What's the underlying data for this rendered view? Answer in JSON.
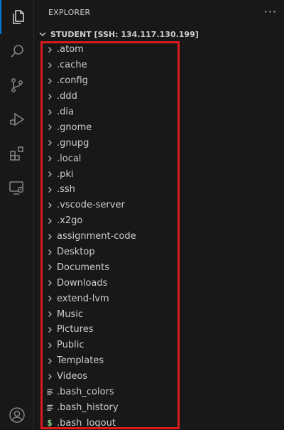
{
  "colors": {
    "background": "#181818",
    "text": "#cccccc",
    "active_indicator": "#0078d4",
    "highlight_border": "#d81c1c",
    "shell_icon": "#89d185"
  },
  "activity_bar": {
    "items": [
      {
        "icon": "files-icon",
        "active": true
      },
      {
        "icon": "search-icon",
        "active": false
      },
      {
        "icon": "source-control-icon",
        "active": false
      },
      {
        "icon": "run-debug-icon",
        "active": false
      },
      {
        "icon": "extensions-icon",
        "active": false
      },
      {
        "icon": "remote-explorer-icon",
        "active": false
      }
    ],
    "bottom_items": [
      {
        "icon": "account-icon"
      }
    ]
  },
  "sidebar": {
    "title": "EXPLORER",
    "more_actions": "···",
    "section": {
      "title": "STUDENT [SSH: 134.117.130.199]"
    },
    "items": [
      {
        "label": ".atom",
        "type": "folder"
      },
      {
        "label": ".cache",
        "type": "folder"
      },
      {
        "label": ".config",
        "type": "folder"
      },
      {
        "label": ".ddd",
        "type": "folder"
      },
      {
        "label": ".dia",
        "type": "folder"
      },
      {
        "label": ".gnome",
        "type": "folder"
      },
      {
        "label": ".gnupg",
        "type": "folder"
      },
      {
        "label": ".local",
        "type": "folder"
      },
      {
        "label": ".pki",
        "type": "folder"
      },
      {
        "label": ".ssh",
        "type": "folder"
      },
      {
        "label": ".vscode-server",
        "type": "folder"
      },
      {
        "label": ".x2go",
        "type": "folder"
      },
      {
        "label": "assignment-code",
        "type": "folder"
      },
      {
        "label": "Desktop",
        "type": "folder"
      },
      {
        "label": "Documents",
        "type": "folder"
      },
      {
        "label": "Downloads",
        "type": "folder"
      },
      {
        "label": "extend-lvm",
        "type": "folder"
      },
      {
        "label": "Music",
        "type": "folder"
      },
      {
        "label": "Pictures",
        "type": "folder"
      },
      {
        "label": "Public",
        "type": "folder"
      },
      {
        "label": "Templates",
        "type": "folder"
      },
      {
        "label": "Videos",
        "type": "folder"
      },
      {
        "label": ".bash_colors",
        "type": "file",
        "icon": "text-file-icon"
      },
      {
        "label": ".bash_history",
        "type": "file",
        "icon": "text-file-icon"
      },
      {
        "label": ".bash_logout",
        "type": "file",
        "icon": "shell-file-icon",
        "glyph": "$"
      }
    ]
  }
}
